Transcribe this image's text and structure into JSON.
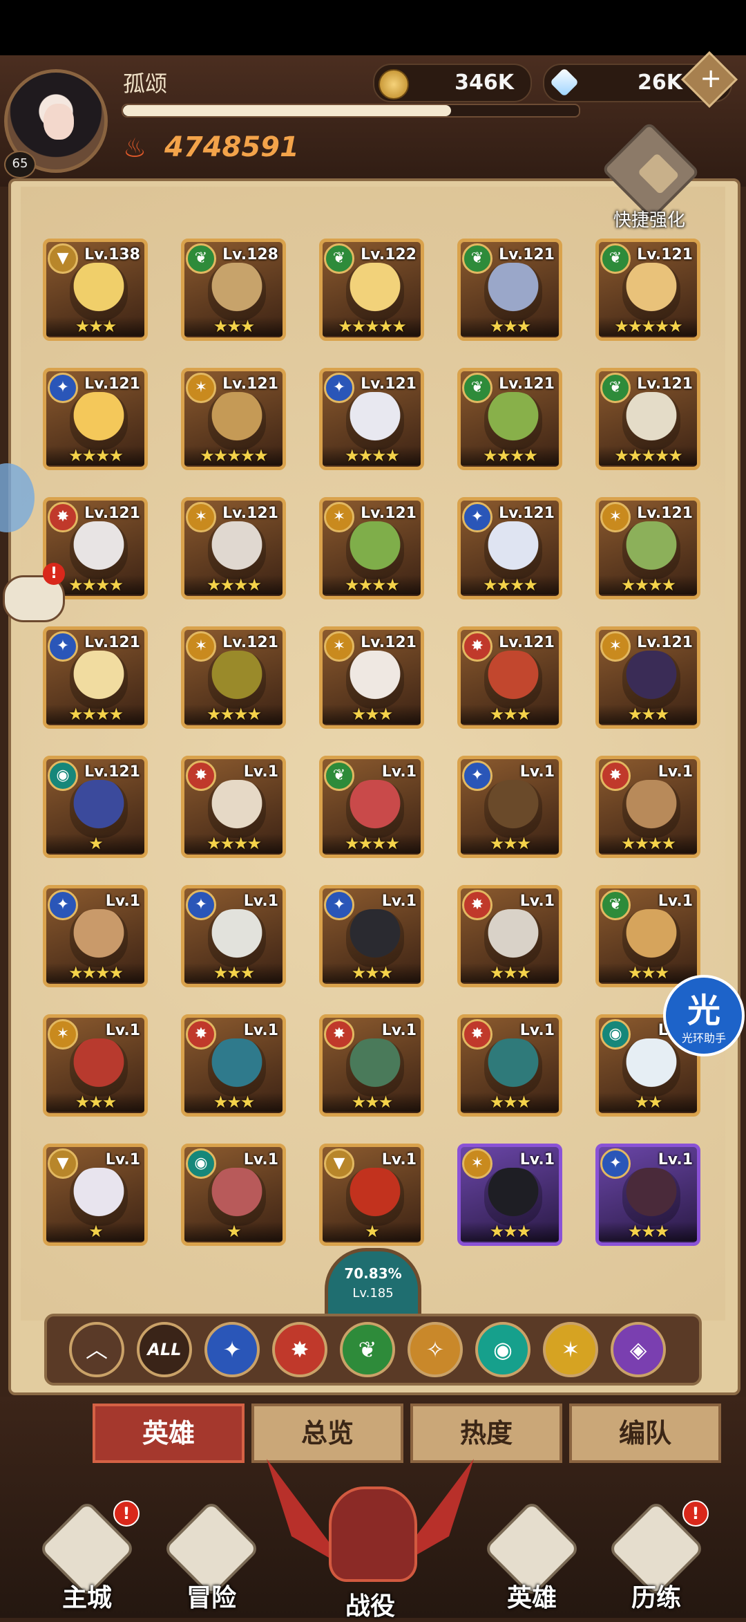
{
  "player": {
    "name": "孤颂",
    "level": "65",
    "xp_fraction": 0.72,
    "power": "4748591"
  },
  "resources": {
    "gold": "346K",
    "gems": "26K",
    "plus": "+"
  },
  "quick_upgrade": {
    "label": "快捷强化"
  },
  "heroes": [
    {
      "faction": "wilder-y",
      "level": "Lv.138",
      "stars": "★★★",
      "face": "#f0cf6a",
      "frame": "gold"
    },
    {
      "faction": "wilder",
      "level": "Lv.128",
      "stars": "★★★",
      "face": "#c7a36b",
      "frame": "gold"
    },
    {
      "faction": "wilder",
      "level": "Lv.122",
      "stars": "★★★★★",
      "face": "#f2d27a",
      "frame": "gold"
    },
    {
      "faction": "wilder",
      "level": "Lv.121",
      "stars": "★★★",
      "face": "#9aa7c9",
      "frame": "gold"
    },
    {
      "faction": "wilder",
      "level": "Lv.121",
      "stars": "★★★★★",
      "face": "#e9c27a",
      "frame": "gold"
    },
    {
      "faction": "lightbearer",
      "level": "Lv.121",
      "stars": "★★★★",
      "face": "#f4c85a",
      "frame": "gold"
    },
    {
      "faction": "celestial",
      "level": "Lv.121",
      "stars": "★★★★★",
      "face": "#c59a56",
      "frame": "gold"
    },
    {
      "faction": "lightbearer",
      "level": "Lv.121",
      "stars": "★★★★",
      "face": "#e8e8f0",
      "frame": "gold"
    },
    {
      "faction": "wilder",
      "level": "Lv.121",
      "stars": "★★★★",
      "face": "#88b04a",
      "frame": "gold"
    },
    {
      "faction": "wilder",
      "level": "Lv.121",
      "stars": "★★★★★",
      "face": "#e4dcc8",
      "frame": "gold"
    },
    {
      "faction": "mauler",
      "level": "Lv.121",
      "stars": "★★★★",
      "face": "#e8e4e4",
      "frame": "gold"
    },
    {
      "faction": "celestial",
      "level": "Lv.121",
      "stars": "★★★★",
      "face": "#e0d8d0",
      "frame": "gold"
    },
    {
      "faction": "celestial",
      "level": "Lv.121",
      "stars": "★★★★",
      "face": "#7fae4a",
      "frame": "gold"
    },
    {
      "faction": "lightbearer",
      "level": "Lv.121",
      "stars": "★★★★",
      "face": "#dfe4f2",
      "frame": "gold"
    },
    {
      "faction": "celestial",
      "level": "Lv.121",
      "stars": "★★★★",
      "face": "#8cb05a",
      "frame": "gold"
    },
    {
      "faction": "lightbearer",
      "level": "Lv.121",
      "stars": "★★★★",
      "face": "#f1dca0",
      "frame": "gold"
    },
    {
      "faction": "celestial",
      "level": "Lv.121",
      "stars": "★★★★",
      "face": "#9a8a2a",
      "frame": "gold"
    },
    {
      "faction": "celestial",
      "level": "Lv.121",
      "stars": "★★★",
      "face": "#efe8e2",
      "frame": "gold"
    },
    {
      "faction": "mauler",
      "level": "Lv.121",
      "stars": "★★★",
      "face": "#c2472e",
      "frame": "gold"
    },
    {
      "faction": "celestial",
      "level": "Lv.121",
      "stars": "★★★",
      "face": "#3a2c56",
      "frame": "gold"
    },
    {
      "faction": "dimensional",
      "level": "Lv.121",
      "stars": "★",
      "face": "#3b4a9c",
      "frame": "gold"
    },
    {
      "faction": "mauler",
      "level": "Lv.1",
      "stars": "★★★★",
      "face": "#e6d9c6",
      "frame": "gold"
    },
    {
      "faction": "wilder",
      "level": "Lv.1",
      "stars": "★★★★",
      "face": "#c94a4a",
      "frame": "gold"
    },
    {
      "faction": "lightbearer",
      "level": "Lv.1",
      "stars": "★★★",
      "face": "#6a4a2a",
      "frame": "gold"
    },
    {
      "faction": "mauler",
      "level": "Lv.1",
      "stars": "★★★★",
      "face": "#b88a5a",
      "frame": "gold"
    },
    {
      "faction": "lightbearer",
      "level": "Lv.1",
      "stars": "★★★★",
      "face": "#c99a6a",
      "frame": "gold"
    },
    {
      "faction": "lightbearer",
      "level": "Lv.1",
      "stars": "★★★",
      "face": "#e2e2dc",
      "frame": "gold"
    },
    {
      "faction": "lightbearer",
      "level": "Lv.1",
      "stars": "★★★",
      "face": "#2a2a30",
      "frame": "gold"
    },
    {
      "faction": "mauler",
      "level": "Lv.1",
      "stars": "★★★",
      "face": "#d9d2c8",
      "frame": "gold"
    },
    {
      "faction": "wilder",
      "level": "Lv.1",
      "stars": "★★★",
      "face": "#d6a45c",
      "frame": "gold"
    },
    {
      "faction": "celestial",
      "level": "Lv.1",
      "stars": "★★★",
      "face": "#b83a2e",
      "frame": "gold"
    },
    {
      "faction": "mauler",
      "level": "Lv.1",
      "stars": "★★★",
      "face": "#2f7a8c",
      "frame": "gold"
    },
    {
      "faction": "mauler",
      "level": "Lv.1",
      "stars": "★★★",
      "face": "#4a7a5a",
      "frame": "gold"
    },
    {
      "faction": "mauler",
      "level": "Lv.1",
      "stars": "★★★",
      "face": "#2f7a7a",
      "frame": "gold"
    },
    {
      "faction": "dimensional",
      "level": "Lv.1",
      "stars": "★★",
      "face": "#e6eef4",
      "frame": "gold"
    },
    {
      "faction": "wilder-y",
      "level": "Lv.1",
      "stars": "★",
      "face": "#e8e4ee",
      "frame": "gold"
    },
    {
      "faction": "dimensional",
      "level": "Lv.1",
      "stars": "★",
      "face": "#b85a5a",
      "frame": "gold"
    },
    {
      "faction": "wilder-y",
      "level": "Lv.1",
      "stars": "★",
      "face": "#c2321e",
      "frame": "gold"
    },
    {
      "faction": "celestial",
      "level": "Lv.1",
      "stars": "★★★",
      "face": "#1e1e24",
      "frame": "purple"
    },
    {
      "faction": "lightbearer",
      "level": "Lv.1",
      "stars": "★★★",
      "face": "#4a2a3a",
      "frame": "purple"
    }
  ],
  "progress": {
    "percent": "70.83%",
    "level": "Lv.185"
  },
  "filters": [
    {
      "name": "collapse",
      "glyph": "︿",
      "color": "#5a3a28"
    },
    {
      "name": "all",
      "glyph": "ALL",
      "color": "#3a2418"
    },
    {
      "name": "lightbearer",
      "glyph": "✦",
      "color": "#2a56b8"
    },
    {
      "name": "mauler",
      "glyph": "✸",
      "color": "#c0392b"
    },
    {
      "name": "wilder",
      "glyph": "❦",
      "color": "#2e8b3a"
    },
    {
      "name": "graveborn",
      "glyph": "✧",
      "color": "#c9882a"
    },
    {
      "name": "dimensional",
      "glyph": "◉",
      "color": "#16a08c"
    },
    {
      "name": "celestial",
      "glyph": "✶",
      "color": "#d6a322"
    },
    {
      "name": "hypogean",
      "glyph": "◈",
      "color": "#7a3fb0"
    }
  ],
  "tabs": [
    {
      "label": "英雄",
      "active": true
    },
    {
      "label": "总览",
      "active": false
    },
    {
      "label": "热度",
      "active": false
    },
    {
      "label": "编队",
      "active": false
    }
  ],
  "nav": [
    {
      "label": "主城",
      "badge": "!"
    },
    {
      "label": "冒险",
      "badge": ""
    },
    {
      "label": "战役",
      "badge": ""
    },
    {
      "label": "英雄",
      "badge": ""
    },
    {
      "label": "历练",
      "badge": "!"
    }
  ],
  "side": {
    "chat_badge": "!"
  },
  "assistant": {
    "glyph": "光",
    "label": "光环助手"
  },
  "colors": {
    "lightbearer": "#2a56b8",
    "mauler": "#c0392b",
    "wilder": "#2e8b3a",
    "wilder-y": "#b8862a",
    "celestial": "#c98a1e",
    "dimensional": "#16877a",
    "graveborn": "#c9882a",
    "hypogean": "#7a3fb0"
  }
}
